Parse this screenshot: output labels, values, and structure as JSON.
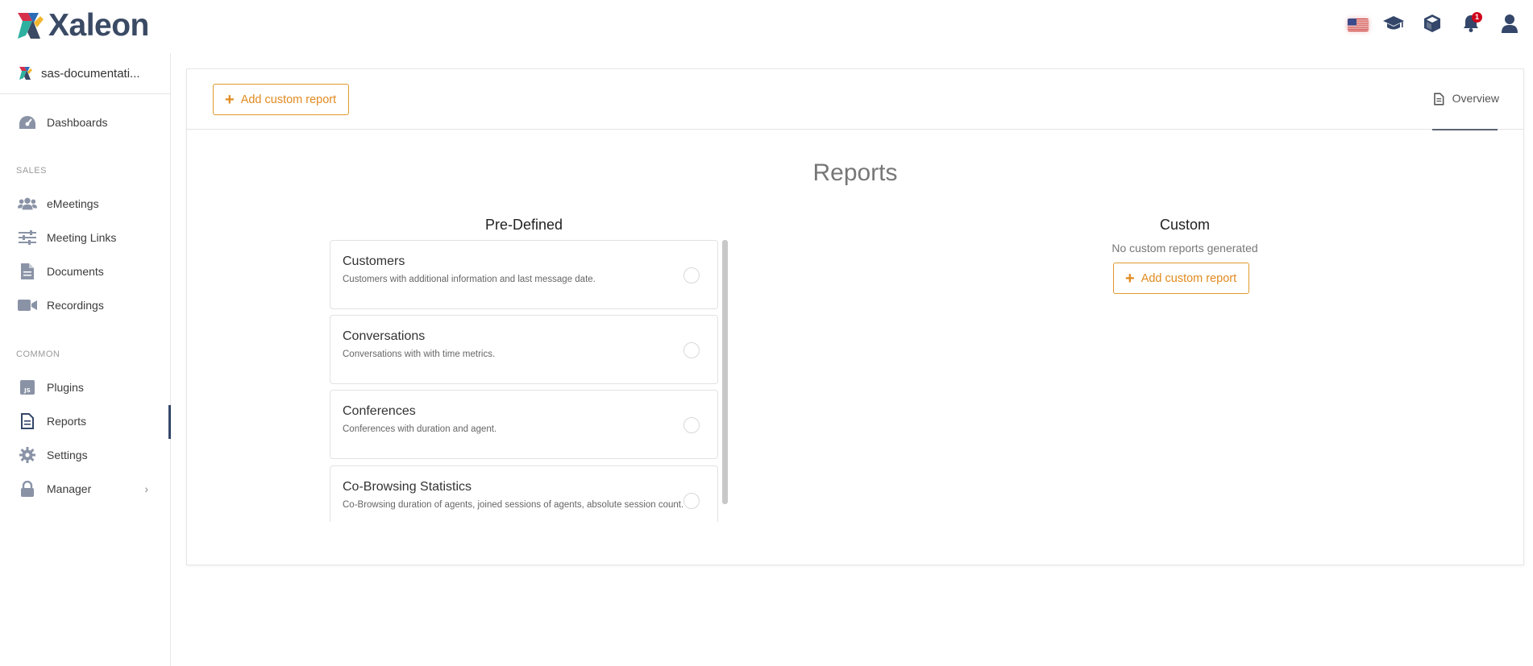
{
  "app": {
    "brand": "Xaleon"
  },
  "topbar": {
    "icons": [
      "us-flag-icon",
      "graduation-cap-icon",
      "cube-icon",
      "bell-icon",
      "user-icon"
    ],
    "notification_count": "1"
  },
  "sidebar": {
    "workspace": "sas-documentati...",
    "sections": {
      "sales": "SALES",
      "common": "COMMON"
    },
    "items": [
      {
        "label": "Dashboards",
        "icon": "speedometer-icon"
      },
      {
        "label": "eMeetings",
        "icon": "users-icon"
      },
      {
        "label": "Meeting Links",
        "icon": "sliders-icon"
      },
      {
        "label": "Documents",
        "icon": "file-icon"
      },
      {
        "label": "Recordings",
        "icon": "video-camera-icon"
      },
      {
        "label": "Plugins",
        "icon": "js-icon"
      },
      {
        "label": "Reports",
        "icon": "report-icon",
        "active": true
      },
      {
        "label": "Settings",
        "icon": "gear-icon"
      },
      {
        "label": "Manager",
        "icon": "lock-icon",
        "chevron": "›"
      }
    ]
  },
  "header": {
    "add_button": "Add custom report",
    "tab_overview": "Overview"
  },
  "main": {
    "title": "Reports",
    "predefined_title": "Pre-Defined",
    "custom_title": "Custom",
    "no_custom_text": "No custom reports generated",
    "custom_add_button": "Add custom report",
    "reports": [
      {
        "title": "Customers",
        "desc": "Customers with additional information and last message date."
      },
      {
        "title": "Conversations",
        "desc": "Conversations with with time metrics."
      },
      {
        "title": "Conferences",
        "desc": "Conferences with duration and agent."
      },
      {
        "title": "Co-Browsing Statistics",
        "desc": "Co-Browsing duration of agents, joined sessions of agents, absolute session count."
      }
    ]
  },
  "colors": {
    "accent": "#e08a1e",
    "nav_icon": "#8a93a6",
    "brand_dark": "#34476a",
    "badge": "#d0021b"
  }
}
